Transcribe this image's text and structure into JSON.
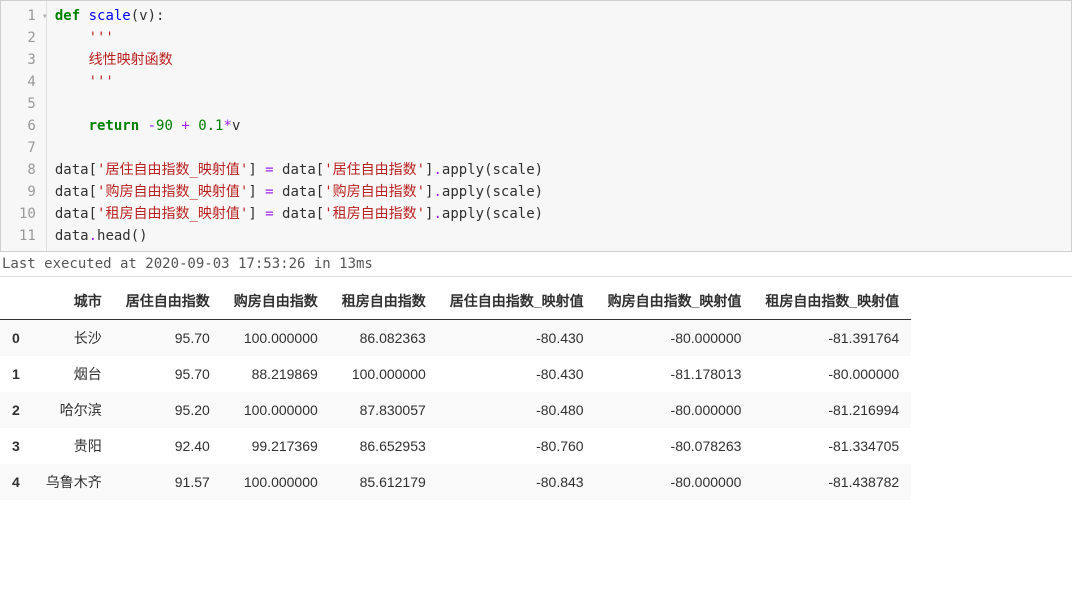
{
  "code": {
    "lines": [
      {
        "n": "1",
        "fold": true,
        "html": "<span class='kw'>def</span> <span class='fn'>scale</span>(v):"
      },
      {
        "n": "2",
        "html": "    <span class='str'>'''</span>"
      },
      {
        "n": "3",
        "html": "    <span class='str'>线性映射函数</span>"
      },
      {
        "n": "4",
        "html": "    <span class='str'>'''</span>"
      },
      {
        "n": "5",
        "html": ""
      },
      {
        "n": "6",
        "html": "    <span class='kw'>return</span> <span class='op'>-</span><span class='num'>90</span> <span class='op'>+</span> <span class='num'>0.1</span><span class='op'>*</span>v"
      },
      {
        "n": "7",
        "html": ""
      },
      {
        "n": "8",
        "html": "data[<span class='str'>'居住自由指数_映射值'</span>] <span class='op'>=</span> data[<span class='str'>'居住自由指数'</span>]<span class='op'>.</span>apply(scale)"
      },
      {
        "n": "9",
        "html": "data[<span class='str'>'购房自由指数_映射值'</span>] <span class='op'>=</span> data[<span class='str'>'购房自由指数'</span>]<span class='op'>.</span>apply(scale)"
      },
      {
        "n": "10",
        "html": "data[<span class='str'>'租房自由指数_映射值'</span>] <span class='op'>=</span> data[<span class='str'>'租房自由指数'</span>]<span class='op'>.</span>apply(scale)"
      },
      {
        "n": "11",
        "html": "data<span class='op'>.</span>head()"
      }
    ]
  },
  "exec_info": "Last executed at 2020-09-03 17:53:26 in 13ms",
  "table": {
    "columns": [
      "",
      "城市",
      "居住自由指数",
      "购房自由指数",
      "租房自由指数",
      "居住自由指数_映射值",
      "购房自由指数_映射值",
      "租房自由指数_映射值"
    ],
    "rows": [
      {
        "idx": "0",
        "城市": "长沙",
        "c1": "95.70",
        "c2": "100.000000",
        "c3": "86.082363",
        "c4": "-80.430",
        "c5": "-80.000000",
        "c6": "-81.391764"
      },
      {
        "idx": "1",
        "城市": "烟台",
        "c1": "95.70",
        "c2": "88.219869",
        "c3": "100.000000",
        "c4": "-80.430",
        "c5": "-81.178013",
        "c6": "-80.000000"
      },
      {
        "idx": "2",
        "城市": "哈尔滨",
        "c1": "95.20",
        "c2": "100.000000",
        "c3": "87.830057",
        "c4": "-80.480",
        "c5": "-80.000000",
        "c6": "-81.216994"
      },
      {
        "idx": "3",
        "城市": "贵阳",
        "c1": "92.40",
        "c2": "99.217369",
        "c3": "86.652953",
        "c4": "-80.760",
        "c5": "-80.078263",
        "c6": "-81.334705"
      },
      {
        "idx": "4",
        "城市": "乌鲁木齐",
        "c1": "91.57",
        "c2": "100.000000",
        "c3": "85.612179",
        "c4": "-80.843",
        "c5": "-80.000000",
        "c6": "-81.438782"
      }
    ]
  }
}
